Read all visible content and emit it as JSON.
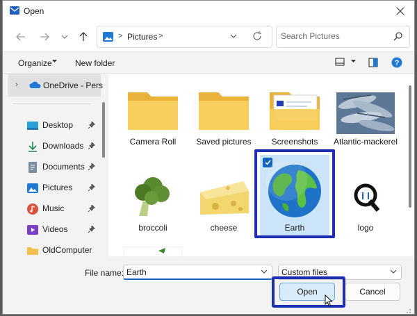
{
  "window": {
    "title": "Open",
    "title_icon": "mail-icon",
    "close_icon": "close-icon"
  },
  "nav": {
    "back_icon": "back-arrow-icon",
    "forward_icon": "forward-arrow-icon",
    "recent_icon": "chevron-down-icon",
    "up_icon": "up-arrow-icon",
    "address": {
      "icon": "pictures-folder-icon",
      "segment": "Pictures",
      "separator": ">"
    },
    "refresh_icon": "refresh-icon",
    "search": {
      "placeholder": "Search Pictures",
      "icon": "search-icon"
    }
  },
  "toolbar": {
    "organize_label": "Organize",
    "new_folder_label": "New folder",
    "view_icon": "view-layout-icon",
    "preview_pane_icon": "preview-pane-icon",
    "help_icon": "help-icon"
  },
  "sidebar": {
    "onedrive_label": "OneDrive - Personal",
    "items": [
      {
        "label": "Desktop",
        "icon": "desktop-icon",
        "pinned": true
      },
      {
        "label": "Downloads",
        "icon": "download-icon",
        "pinned": true
      },
      {
        "label": "Documents",
        "icon": "documents-icon",
        "pinned": true
      },
      {
        "label": "Pictures",
        "icon": "pictures-icon",
        "pinned": true
      },
      {
        "label": "Music",
        "icon": "music-icon",
        "pinned": true
      },
      {
        "label": "Videos",
        "icon": "videos-icon",
        "pinned": true
      },
      {
        "label": "OldComputer",
        "icon": "folder-icon",
        "pinned": false
      }
    ]
  },
  "files": [
    {
      "name": "Camera Roll",
      "kind": "folder"
    },
    {
      "name": "Saved pictures",
      "kind": "folder"
    },
    {
      "name": "Screenshots",
      "kind": "folder-with-preview"
    },
    {
      "name": "Atlantic-mackerel",
      "kind": "image"
    },
    {
      "name": "broccoli",
      "kind": "image"
    },
    {
      "name": "cheese",
      "kind": "image"
    },
    {
      "name": "Earth",
      "kind": "image",
      "selected": true
    },
    {
      "name": "logo",
      "kind": "image"
    }
  ],
  "footer": {
    "file_name_label": "File name:",
    "file_name_value": "Earth",
    "file_type_value": "Custom files",
    "open_label": "Open",
    "cancel_label": "Cancel"
  },
  "colors": {
    "accent": "#1565c0",
    "highlight_border": "#1e2fb4",
    "selection_bg": "#cce4f7"
  }
}
